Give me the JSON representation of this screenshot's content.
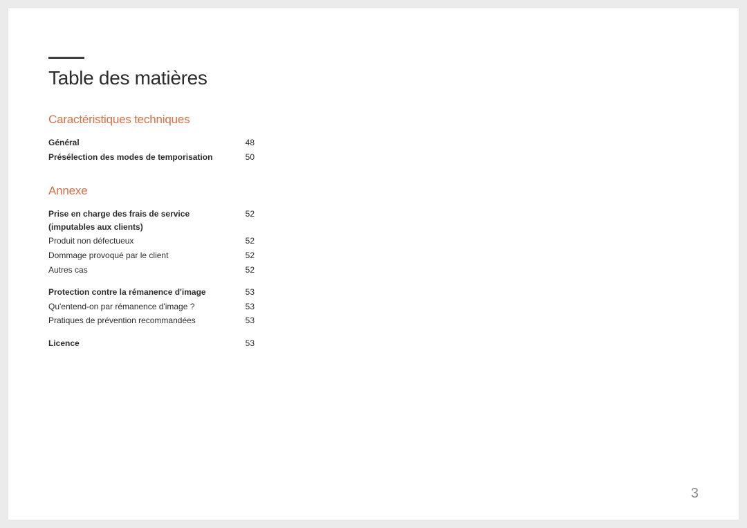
{
  "page": {
    "title": "Table des matières",
    "number": "3"
  },
  "sections": [
    {
      "heading": "Caractéristiques techniques",
      "groups": [
        [
          {
            "label": "Général",
            "page": "48",
            "bold": true
          },
          {
            "label": "Présélection des modes de temporisation",
            "page": "50",
            "bold": true
          }
        ]
      ]
    },
    {
      "heading": "Annexe",
      "groups": [
        [
          {
            "label": "Prise en charge des frais de service (imputables aux clients)",
            "page": "52",
            "bold": true
          },
          {
            "label": "Produit non défectueux",
            "page": "52",
            "bold": false
          },
          {
            "label": "Dommage provoqué par le client",
            "page": "52",
            "bold": false
          },
          {
            "label": "Autres cas",
            "page": "52",
            "bold": false
          }
        ],
        [
          {
            "label": "Protection contre la rémanence d'image",
            "page": "53",
            "bold": true
          },
          {
            "label": "Qu'entend-on par rémanence d'image ?",
            "page": "53",
            "bold": false
          },
          {
            "label": "Pratiques de prévention recommandées",
            "page": "53",
            "bold": false
          }
        ],
        [
          {
            "label": "Licence",
            "page": "53",
            "bold": true
          }
        ]
      ]
    }
  ]
}
